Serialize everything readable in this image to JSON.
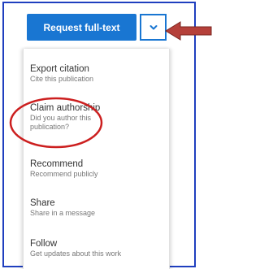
{
  "request_button": {
    "label": "Request full-text"
  },
  "dropdown": {
    "icon": "chevron-down-icon"
  },
  "menu": {
    "items": [
      {
        "title": "Export citation",
        "description": "Cite this publication"
      },
      {
        "title": "Claim authorship",
        "description": "Did you author this publication?"
      },
      {
        "title": "Recommend",
        "description": "Recommend publicly"
      },
      {
        "title": "Share",
        "description": "Share in a message"
      },
      {
        "title": "Follow",
        "description": "Get updates about this work"
      }
    ]
  },
  "colors": {
    "accent": "#1976d2",
    "frame_border": "#1f3fbf",
    "annotation_circle": "#cc1f1f",
    "annotation_arrow": "#b5403a"
  }
}
